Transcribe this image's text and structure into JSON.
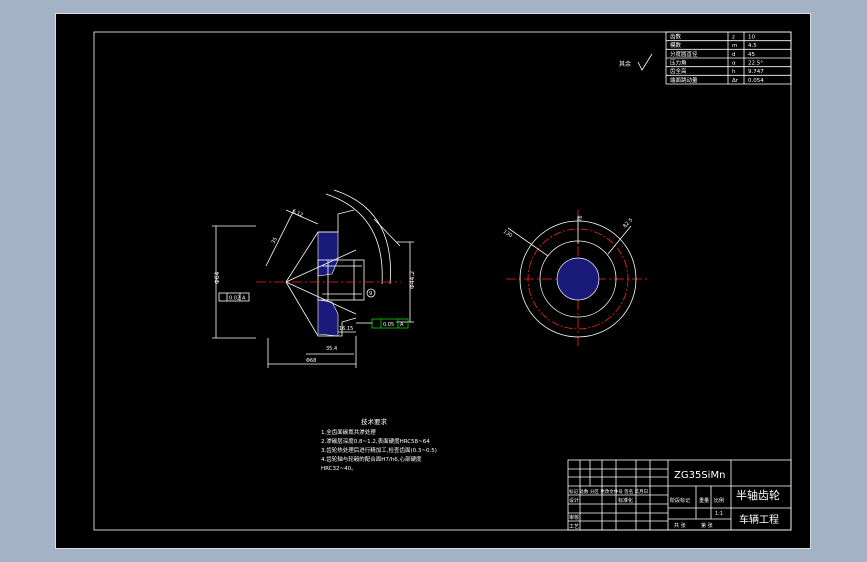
{
  "colors": {
    "background": "#a4b2c6",
    "canvas": "#000000",
    "line": "#ffffff",
    "centerline": "#ff2020",
    "hatch": "#1a1a7a",
    "datum_box": "#00c000"
  },
  "parameter_table": [
    {
      "name": "齿数",
      "symbol": "z",
      "value": "10"
    },
    {
      "name": "模数",
      "symbol": "m",
      "value": "4.5"
    },
    {
      "name": "分度圆直径",
      "symbol": "d",
      "value": "45"
    },
    {
      "name": "压力角",
      "symbol": "α",
      "value": "22.5°"
    },
    {
      "name": "齿全高",
      "symbol": "h",
      "value": "9.747"
    },
    {
      "name": "端面跳动量",
      "symbol": "Δr",
      "value": "0.054"
    }
  ],
  "roughness_note": "其余",
  "dims": {
    "left_outer": "Φ64",
    "right_outer": "Φ44.2",
    "bottom_len": "Φ68",
    "bottom_short": "35.4",
    "inner_len": "16.15",
    "top_slant": "35",
    "datum_a": "A",
    "datum_flat": "0.02",
    "datum_green": "0.05",
    "top_small": "6.12",
    "right_circle": "9",
    "circle_left": "130",
    "circle_right": "82.5",
    "circle_top": "26"
  },
  "notes": {
    "title": "技术要求",
    "items": [
      "1.全齿面碳氮共渗处理",
      "2.渗碳层深度0.8~1.2,表面硬度HRC58~64",
      "3.齿轮热处理后进行精加工,检查齿面(0.3~0.5)",
      "4.齿轮轴与轮毂的配合面H7/h6,心部硬度",
      "HRC32~40。"
    ]
  },
  "title_block": {
    "material": "ZG35SiMn",
    "part_name": "半轴齿轮",
    "org": "车辆工程",
    "scale": "1:1",
    "label_stage": "阶段标记",
    "label_weight": "重量",
    "label_scale": "比例",
    "label_sheets": "共 张",
    "label_sheet_no": "第 张",
    "label_design": "设计",
    "label_std": "标准化",
    "label_review": "审核",
    "label_process": "工艺",
    "label_marks": "标记 处数 分区 更改文件号 签名 年月日"
  }
}
